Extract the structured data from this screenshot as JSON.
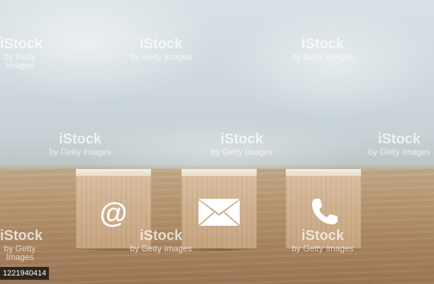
{
  "watermark": {
    "brand": "iStock",
    "credit": "by Getty Images"
  },
  "image_id": "1221940414",
  "blocks": [
    {
      "icon": "at-sign-icon",
      "glyph": "@"
    },
    {
      "icon": "envelope-icon"
    },
    {
      "icon": "phone-icon"
    }
  ],
  "colors": {
    "background_blur": "#cfd9dd",
    "table_wood": "#a98460",
    "block_wood": "#cfb190",
    "icon": "#ffffff"
  }
}
